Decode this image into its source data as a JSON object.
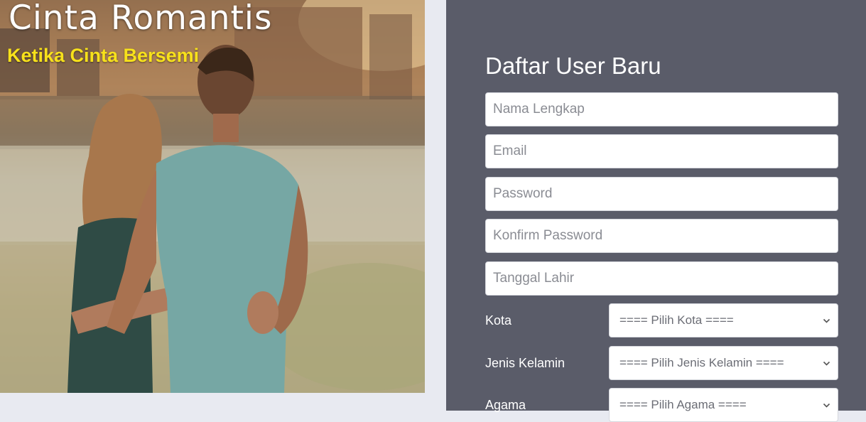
{
  "hero": {
    "title": "Cinta Romantis",
    "subtitle": "Ketika Cinta Bersemi"
  },
  "form": {
    "title": "Daftar User Baru",
    "fields": {
      "nama_lengkap": {
        "placeholder": "Nama Lengkap",
        "value": ""
      },
      "email": {
        "placeholder": "Email",
        "value": ""
      },
      "password": {
        "placeholder": "Password",
        "value": ""
      },
      "konfirm_password": {
        "placeholder": "Konfirm Password",
        "value": ""
      },
      "tanggal_lahir": {
        "placeholder": "Tanggal Lahir",
        "value": ""
      }
    },
    "selects": {
      "kota": {
        "label": "Kota",
        "selected": "==== Pilih Kota ===="
      },
      "jenis_kelamin": {
        "label": "Jenis Kelamin",
        "selected": "==== Pilih Jenis Kelamin ===="
      },
      "agama": {
        "label": "Agama",
        "selected": "==== Pilih Agama ===="
      }
    },
    "icons": {
      "select_arrow": "chevron-down-icon"
    }
  },
  "colors": {
    "page_background": "#e8eaf1",
    "panel_background": "#5a5c69",
    "hero_title": "#ffffff",
    "hero_subtitle": "#f7e11b",
    "field_background": "#ffffff"
  }
}
